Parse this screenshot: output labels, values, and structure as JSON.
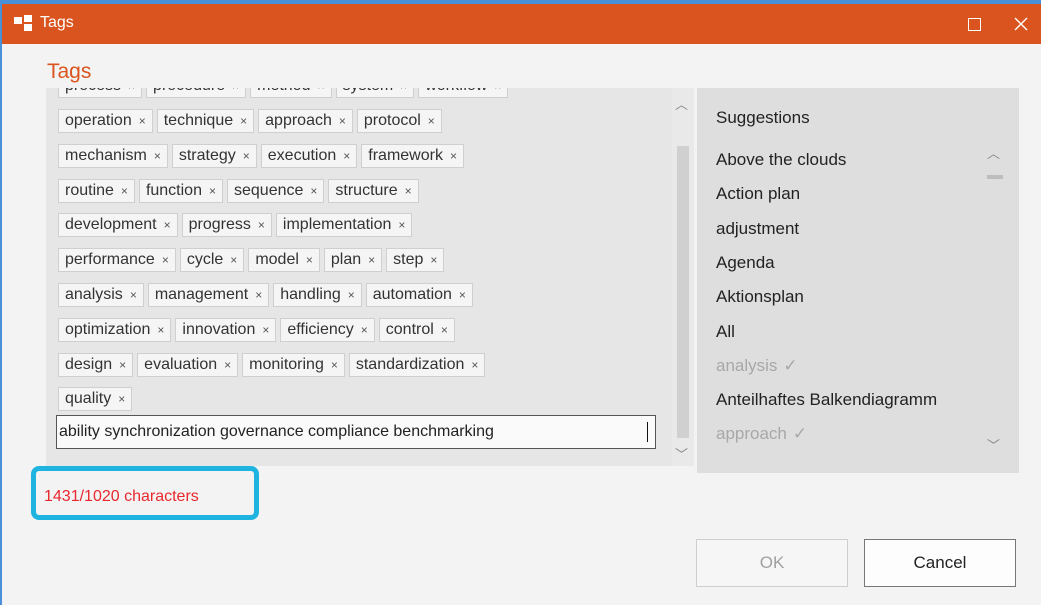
{
  "window": {
    "title": "Tags"
  },
  "heading": "Tags",
  "tag_rows": [
    [
      "operation",
      "technique",
      "approach",
      "protocol"
    ],
    [
      "mechanism",
      "strategy",
      "execution",
      "framework"
    ],
    [
      "routine",
      "function",
      "sequence",
      "structure"
    ],
    [
      "development",
      "progress",
      "implementation"
    ],
    [
      "performance",
      "cycle",
      "model",
      "plan",
      "step"
    ],
    [
      "analysis",
      "management",
      "handling",
      "automation"
    ],
    [
      "optimization",
      "innovation",
      "efficiency",
      "control"
    ],
    [
      "design",
      "evaluation",
      "monitoring",
      "standardization"
    ],
    [
      "quality"
    ]
  ],
  "partial_row": [
    "process",
    "procedure",
    "method",
    "system",
    "workflow"
  ],
  "tag_remove_glyph": "×",
  "input": {
    "value": "ability synchronization governance compliance benchmarking"
  },
  "suggestions": {
    "title": "Suggestions",
    "items": [
      {
        "label": "Above the clouds",
        "used": false
      },
      {
        "label": "Action plan",
        "used": false
      },
      {
        "label": "adjustment",
        "used": false
      },
      {
        "label": "Agenda",
        "used": false
      },
      {
        "label": "Aktionsplan",
        "used": false
      },
      {
        "label": "All",
        "used": false
      },
      {
        "label": "analysis",
        "used": true
      },
      {
        "label": "Anteilhaftes Balkendiagramm",
        "used": false
      },
      {
        "label": "approach",
        "used": true
      }
    ],
    "used_mark": "✓"
  },
  "counter": "1431/1020 characters",
  "buttons": {
    "ok": "OK",
    "cancel": "Cancel"
  },
  "colors": {
    "accent": "#d9541e",
    "error": "#e8272e",
    "highlight": "#1fb4e0"
  }
}
